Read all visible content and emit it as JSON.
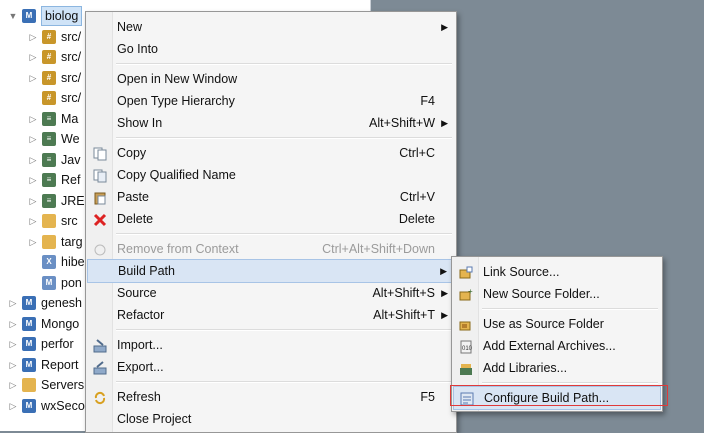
{
  "tree": {
    "rows": [
      {
        "label": "biolog",
        "icon": "maven-project-icon",
        "twisty": "▼",
        "selected": true,
        "color": "#3a6fb5",
        "badge": "M"
      },
      {
        "label": "src/",
        "icon": "source-folder-icon",
        "twisty": "▷",
        "color": "#c8962a",
        "badge": "#"
      },
      {
        "label": "src/",
        "icon": "source-folder-icon",
        "twisty": "▷",
        "color": "#c8962a",
        "badge": "#"
      },
      {
        "label": "src/",
        "icon": "source-folder-icon",
        "twisty": "▷",
        "color": "#c8962a",
        "badge": "#"
      },
      {
        "label": "src/",
        "icon": "source-folder-icon",
        "twisty": "",
        "color": "#c8962a",
        "badge": "#"
      },
      {
        "label": "Ma",
        "icon": "library-icon",
        "twisty": "▷",
        "color": "#4d7a52",
        "badge": "≡"
      },
      {
        "label": "We",
        "icon": "library-icon",
        "twisty": "▷",
        "color": "#4d7a52",
        "badge": "≡"
      },
      {
        "label": "Jav",
        "icon": "library-icon",
        "twisty": "▷",
        "color": "#4d7a52",
        "badge": "≡"
      },
      {
        "label": "Ref",
        "icon": "library-icon",
        "twisty": "▷",
        "color": "#4d7a52",
        "badge": "≡"
      },
      {
        "label": "JRE",
        "icon": "library-icon",
        "twisty": "▷",
        "color": "#4d7a52",
        "badge": "≡"
      },
      {
        "label": "src",
        "icon": "folder-icon",
        "twisty": "▷",
        "color": "#e4b44f",
        "badge": ""
      },
      {
        "label": "targ",
        "icon": "folder-icon",
        "twisty": "▷",
        "color": "#e4b44f",
        "badge": ""
      },
      {
        "label": "hibe",
        "icon": "xml-file-icon",
        "twisty": "",
        "color": "#6a8fc4",
        "badge": "X"
      },
      {
        "label": "pon",
        "icon": "pom-file-icon",
        "twisty": "",
        "color": "#6a8fc4",
        "badge": "M"
      },
      {
        "label": "genesh",
        "icon": "maven-project-icon",
        "twisty": "▷",
        "color": "#3a6fb5",
        "badge": "M"
      },
      {
        "label": "Mongo",
        "icon": "maven-project-icon",
        "twisty": "▷",
        "color": "#3a6fb5",
        "badge": "M"
      },
      {
        "label": "perfor",
        "icon": "maven-project-icon",
        "twisty": "▷",
        "color": "#3a6fb5",
        "badge": "M"
      },
      {
        "label": "Report",
        "icon": "maven-project-icon",
        "twisty": "▷",
        "color": "#3a6fb5",
        "badge": "M"
      },
      {
        "label": "Servers",
        "icon": "folder-icon",
        "twisty": "▷",
        "color": "#e4b44f",
        "badge": ""
      },
      {
        "label": "wxSeco",
        "icon": "maven-project-icon",
        "twisty": "▷",
        "color": "#3a6fb5",
        "badge": "M"
      }
    ]
  },
  "menu": {
    "items": [
      {
        "label": "New",
        "accel": "",
        "submenu": true,
        "icon": ""
      },
      {
        "label": "Go Into",
        "accel": "",
        "submenu": false,
        "icon": ""
      },
      {
        "sep": true
      },
      {
        "label": "Open in New Window",
        "accel": "",
        "submenu": false,
        "icon": ""
      },
      {
        "label": "Open Type Hierarchy",
        "accel": "F4",
        "submenu": false,
        "icon": ""
      },
      {
        "label": "Show In",
        "accel": "Alt+Shift+W",
        "submenu": true,
        "icon": ""
      },
      {
        "sep": true
      },
      {
        "label": "Copy",
        "accel": "Ctrl+C",
        "submenu": false,
        "icon": "copy-icon"
      },
      {
        "label": "Copy Qualified Name",
        "accel": "",
        "submenu": false,
        "icon": "copy-qualified-icon"
      },
      {
        "label": "Paste",
        "accel": "Ctrl+V",
        "submenu": false,
        "icon": "paste-icon"
      },
      {
        "label": "Delete",
        "accel": "Delete",
        "submenu": false,
        "icon": "delete-icon"
      },
      {
        "sep": true
      },
      {
        "label": "Remove from Context",
        "accel": "Ctrl+Alt+Shift+Down",
        "submenu": false,
        "icon": "remove-context-icon",
        "disabled": true
      },
      {
        "label": "Build Path",
        "accel": "",
        "submenu": true,
        "icon": "",
        "highlighted": true
      },
      {
        "label": "Source",
        "accel": "Alt+Shift+S",
        "submenu": true,
        "icon": ""
      },
      {
        "label": "Refactor",
        "accel": "Alt+Shift+T",
        "submenu": true,
        "icon": ""
      },
      {
        "sep": true
      },
      {
        "label": "Import...",
        "accel": "",
        "submenu": false,
        "icon": "import-icon"
      },
      {
        "label": "Export...",
        "accel": "",
        "submenu": false,
        "icon": "export-icon"
      },
      {
        "sep": true
      },
      {
        "label": "Refresh",
        "accel": "F5",
        "submenu": false,
        "icon": "refresh-icon"
      },
      {
        "label": "Close Project",
        "accel": "",
        "submenu": false,
        "icon": ""
      }
    ]
  },
  "submenu": {
    "items": [
      {
        "label": "Link Source...",
        "icon": "link-source-icon"
      },
      {
        "label": "New Source Folder...",
        "icon": "new-source-folder-icon"
      },
      {
        "sep": true
      },
      {
        "label": "Use as Source Folder",
        "icon": "use-source-folder-icon"
      },
      {
        "label": "Add External Archives...",
        "icon": "add-archive-icon"
      },
      {
        "label": "Add Libraries...",
        "icon": "add-library-icon"
      },
      {
        "sep": true
      },
      {
        "label": "Configure Build Path...",
        "icon": "configure-build-path-icon",
        "highlighted": true
      }
    ]
  },
  "colors": {
    "highlight_border": "#e03a3a",
    "selection": "#d9e5f4",
    "background": "#7d8a95"
  }
}
